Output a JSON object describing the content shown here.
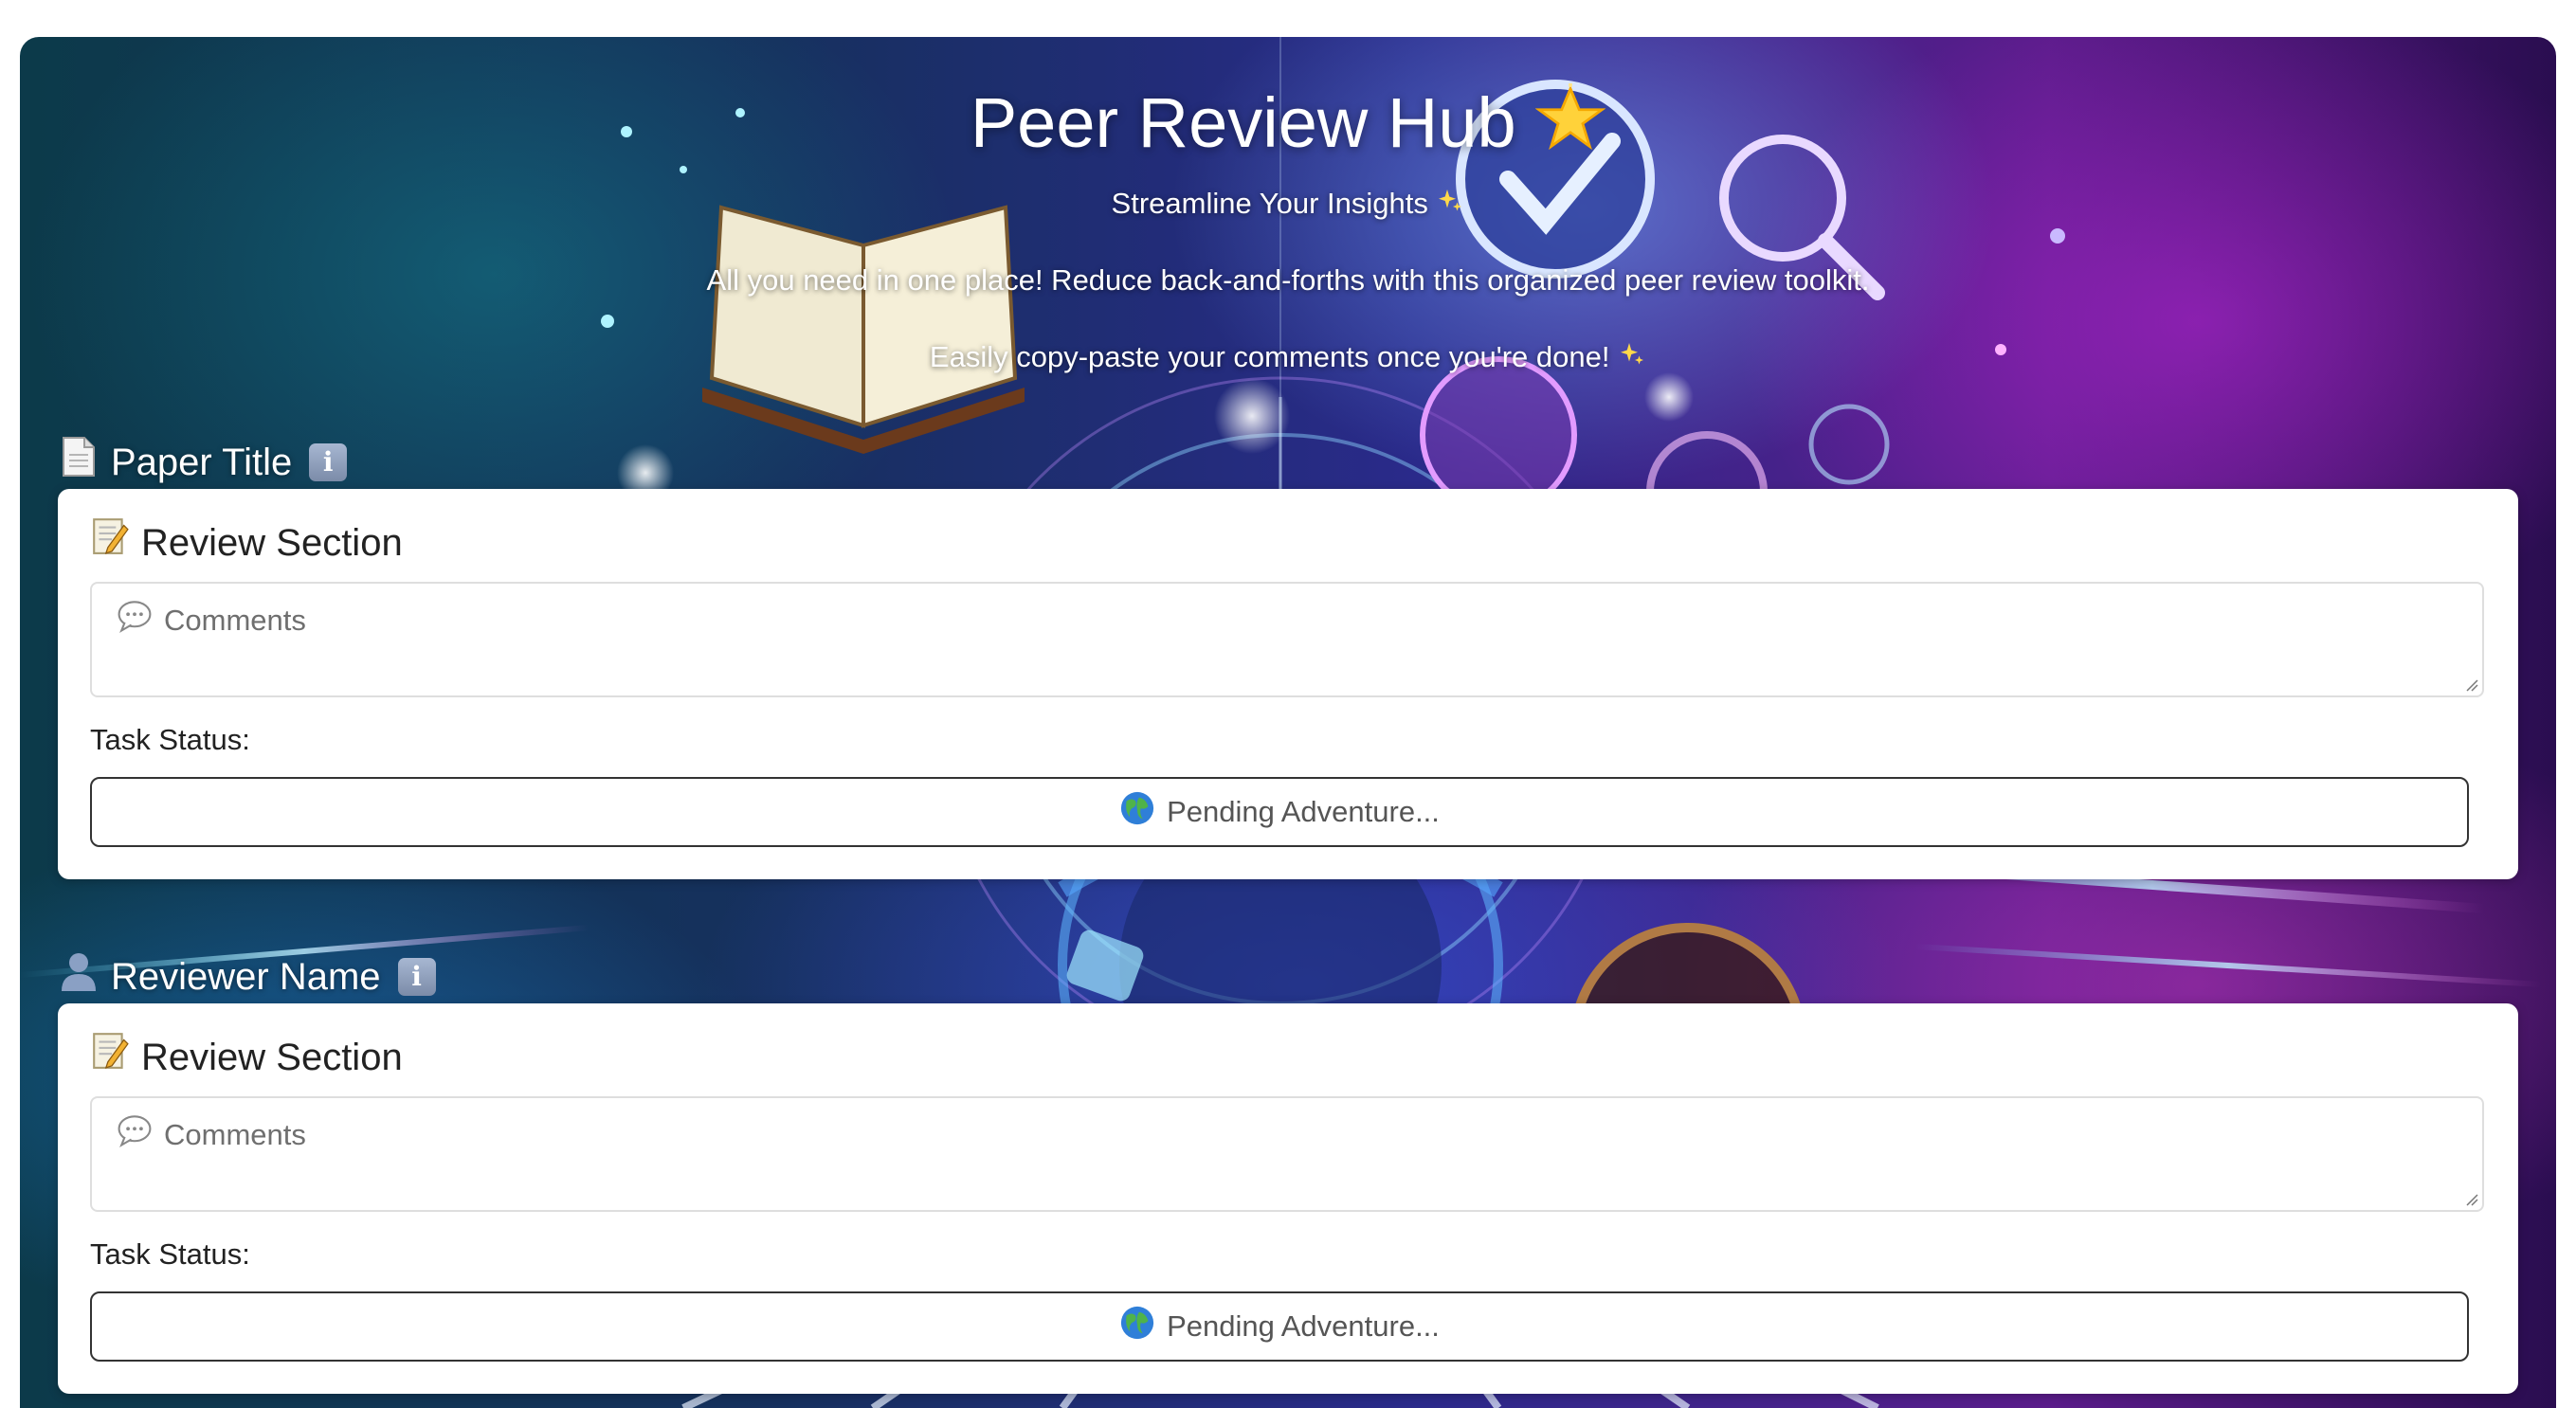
{
  "header": {
    "title": "Peer Review Hub",
    "title_icon": "glowing-star-icon",
    "subtitle": "Streamline Your Insights",
    "subtitle_icon": "sparkles-icon",
    "intro_line_1": "All you need in one place! Reduce back-and-forths with this organized peer review toolkit.",
    "intro_line_2": "Easily copy-paste your comments once you're done!",
    "intro_icon": "sparkles-icon"
  },
  "sections": [
    {
      "heading": "Paper Title",
      "heading_icon": "page-icon",
      "info_icon": "information-icon",
      "info_glyph": "i",
      "card": {
        "title": "Review Section",
        "title_icon": "memo-icon",
        "comments_placeholder": "Comments",
        "comments_icon": "speech-bubble-icon",
        "task_status_label": "Task Status:",
        "status_button_label": "Pending Adventure...",
        "status_button_icon": "globe-icon"
      }
    },
    {
      "heading": "Reviewer Name",
      "heading_icon": "person-icon",
      "info_icon": "information-icon",
      "info_glyph": "i",
      "card": {
        "title": "Review Section",
        "title_icon": "memo-icon",
        "comments_placeholder": "Comments",
        "comments_icon": "speech-bubble-icon",
        "task_status_label": "Task Status:",
        "status_button_label": "Pending Adventure...",
        "status_button_icon": "globe-icon"
      }
    }
  ],
  "colors": {
    "header_text": "#ffffff",
    "card_background": "#ffffff",
    "placeholder_text": "#6f6f6f",
    "button_border": "#333333"
  }
}
